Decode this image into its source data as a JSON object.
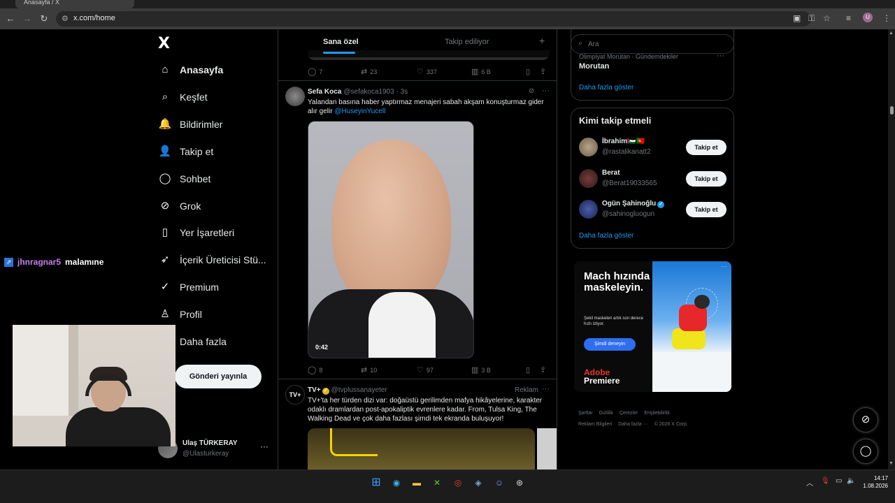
{
  "browser": {
    "tab_title": "Anasayfa / X",
    "url": "x.com/home",
    "profile_initial": "U"
  },
  "nav": {
    "logo": "X",
    "items": [
      {
        "label": "Anasayfa",
        "icon": "home-icon",
        "glyph": "⌂",
        "active": true
      },
      {
        "label": "Keşfet",
        "icon": "search-icon",
        "glyph": "⌕"
      },
      {
        "label": "Bildirimler",
        "icon": "bell-icon",
        "glyph": "🔔"
      },
      {
        "label": "Takip et",
        "icon": "add-person-icon",
        "glyph": "👤"
      },
      {
        "label": "Sohbet",
        "icon": "chat-icon",
        "glyph": "◯"
      },
      {
        "label": "Grok",
        "icon": "grok-icon",
        "glyph": "⊘"
      },
      {
        "label": "Yer İşaretleri",
        "icon": "bookmark-icon",
        "glyph": "▯"
      },
      {
        "label": "İçerik Üreticisi Stü...",
        "icon": "rocket-icon",
        "glyph": "➶"
      },
      {
        "label": "Premium",
        "icon": "verified-icon",
        "glyph": "✓"
      },
      {
        "label": "Profil",
        "icon": "person-icon",
        "glyph": "♙"
      },
      {
        "label": "Daha fazla",
        "icon": "more-icon",
        "glyph": "⋯"
      }
    ],
    "post_button": "Gönderi yayınla",
    "account": {
      "name": "Ulaş TÜRKERAY",
      "handle": "@Ulasturkeray",
      "more": "···"
    }
  },
  "overlay": {
    "chat_user": "jhnragnar5",
    "chat_message": "malamıne"
  },
  "feed": {
    "tabs": [
      {
        "label": "Sana özel",
        "active": true
      },
      {
        "label": "Takip ediliyor",
        "active": false
      }
    ],
    "tab_add": "+",
    "prev_actions": {
      "replies": "7",
      "reposts": "23",
      "likes": "337",
      "views": "6 B"
    },
    "tweet1": {
      "name": "Sefa Koca",
      "handle": "@sefakoca1903 · 3s",
      "text": "Yalandan basına haber yaptırmaz menajeri sabah akşam konuşturmaz gider alır gelir ",
      "mention": "@HuseyinYucell",
      "video_time": "0:42",
      "actions": {
        "replies": "8",
        "reposts": "10",
        "likes": "97",
        "views": "3 B"
      }
    },
    "tweet2": {
      "name": "TV+",
      "handle": "@tvplussanayeter",
      "ad_label": "Reklam",
      "avatar_text": "TV+",
      "text": "TV+'ta her türden dizi var: doğaüstü gerilimden mafya hikâyelerine, karakter odaklı dramlardan post-apokaliptik evrenlere kadar. From, Tulsa King, The Walking Dead ve çok daha fazlası şimdi tek ekranda buluşuyor!"
    }
  },
  "sidebar": {
    "search_placeholder": "Ara",
    "trend": {
      "meta": "Olimpiyat Morutan · Gündemdekiler",
      "name": "Morutan",
      "show_more": "Daha fazla göster"
    },
    "who_to_follow": {
      "title": "Kimi takip etmeli",
      "follow_label": "Takip et",
      "users": [
        {
          "name": "İbrahim🇵🇸🇵🇹",
          "handle": "@rastalikanatt2"
        },
        {
          "name": "Berat",
          "handle": "@Berat19033565"
        },
        {
          "name": "Ogün Şahinoğlu",
          "handle": "@sahinogluogun"
        }
      ],
      "show_more": "Daha fazla göster"
    },
    "promo": {
      "headline": "Mach hızında maskeleyin.",
      "sub": "Şekil maskeleri artık son derece hızlı izliyor.",
      "cta": "Şimdi deneyin",
      "brand1": "Adobe",
      "brand2": "Premiere",
      "more": "···"
    },
    "footer": [
      "Şartlar",
      "Gizlilik",
      "Çerezler",
      "Erişilebilirlik",
      "Reklam Bilgileri",
      "Daha fazla ···",
      "© 2026 X Corp."
    ]
  },
  "taskbar": {
    "time": "14:17",
    "date": "1.08.2026"
  }
}
